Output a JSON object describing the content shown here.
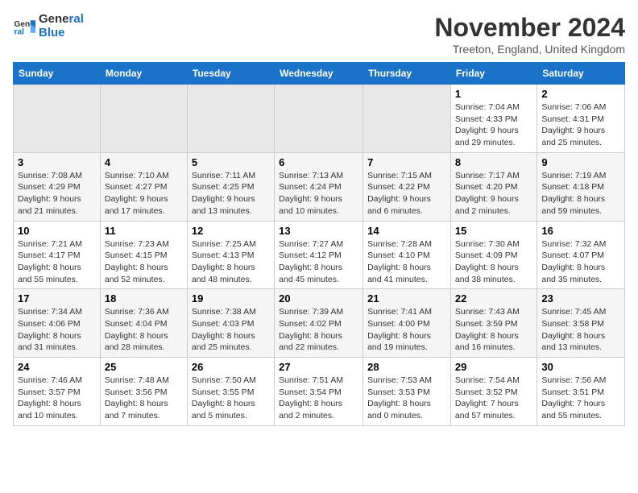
{
  "header": {
    "logo_line1": "General",
    "logo_line2": "Blue",
    "month": "November 2024",
    "location": "Treeton, England, United Kingdom"
  },
  "weekdays": [
    "Sunday",
    "Monday",
    "Tuesday",
    "Wednesday",
    "Thursday",
    "Friday",
    "Saturday"
  ],
  "weeks": [
    [
      {
        "day": "",
        "empty": true
      },
      {
        "day": "",
        "empty": true
      },
      {
        "day": "",
        "empty": true
      },
      {
        "day": "",
        "empty": true
      },
      {
        "day": "",
        "empty": true
      },
      {
        "day": "1",
        "sunrise": "Sunrise: 7:04 AM",
        "sunset": "Sunset: 4:33 PM",
        "daylight": "Daylight: 9 hours and 29 minutes."
      },
      {
        "day": "2",
        "sunrise": "Sunrise: 7:06 AM",
        "sunset": "Sunset: 4:31 PM",
        "daylight": "Daylight: 9 hours and 25 minutes."
      }
    ],
    [
      {
        "day": "3",
        "sunrise": "Sunrise: 7:08 AM",
        "sunset": "Sunset: 4:29 PM",
        "daylight": "Daylight: 9 hours and 21 minutes."
      },
      {
        "day": "4",
        "sunrise": "Sunrise: 7:10 AM",
        "sunset": "Sunset: 4:27 PM",
        "daylight": "Daylight: 9 hours and 17 minutes."
      },
      {
        "day": "5",
        "sunrise": "Sunrise: 7:11 AM",
        "sunset": "Sunset: 4:25 PM",
        "daylight": "Daylight: 9 hours and 13 minutes."
      },
      {
        "day": "6",
        "sunrise": "Sunrise: 7:13 AM",
        "sunset": "Sunset: 4:24 PM",
        "daylight": "Daylight: 9 hours and 10 minutes."
      },
      {
        "day": "7",
        "sunrise": "Sunrise: 7:15 AM",
        "sunset": "Sunset: 4:22 PM",
        "daylight": "Daylight: 9 hours and 6 minutes."
      },
      {
        "day": "8",
        "sunrise": "Sunrise: 7:17 AM",
        "sunset": "Sunset: 4:20 PM",
        "daylight": "Daylight: 9 hours and 2 minutes."
      },
      {
        "day": "9",
        "sunrise": "Sunrise: 7:19 AM",
        "sunset": "Sunset: 4:18 PM",
        "daylight": "Daylight: 8 hours and 59 minutes."
      }
    ],
    [
      {
        "day": "10",
        "sunrise": "Sunrise: 7:21 AM",
        "sunset": "Sunset: 4:17 PM",
        "daylight": "Daylight: 8 hours and 55 minutes."
      },
      {
        "day": "11",
        "sunrise": "Sunrise: 7:23 AM",
        "sunset": "Sunset: 4:15 PM",
        "daylight": "Daylight: 8 hours and 52 minutes."
      },
      {
        "day": "12",
        "sunrise": "Sunrise: 7:25 AM",
        "sunset": "Sunset: 4:13 PM",
        "daylight": "Daylight: 8 hours and 48 minutes."
      },
      {
        "day": "13",
        "sunrise": "Sunrise: 7:27 AM",
        "sunset": "Sunset: 4:12 PM",
        "daylight": "Daylight: 8 hours and 45 minutes."
      },
      {
        "day": "14",
        "sunrise": "Sunrise: 7:28 AM",
        "sunset": "Sunset: 4:10 PM",
        "daylight": "Daylight: 8 hours and 41 minutes."
      },
      {
        "day": "15",
        "sunrise": "Sunrise: 7:30 AM",
        "sunset": "Sunset: 4:09 PM",
        "daylight": "Daylight: 8 hours and 38 minutes."
      },
      {
        "day": "16",
        "sunrise": "Sunrise: 7:32 AM",
        "sunset": "Sunset: 4:07 PM",
        "daylight": "Daylight: 8 hours and 35 minutes."
      }
    ],
    [
      {
        "day": "17",
        "sunrise": "Sunrise: 7:34 AM",
        "sunset": "Sunset: 4:06 PM",
        "daylight": "Daylight: 8 hours and 31 minutes."
      },
      {
        "day": "18",
        "sunrise": "Sunrise: 7:36 AM",
        "sunset": "Sunset: 4:04 PM",
        "daylight": "Daylight: 8 hours and 28 minutes."
      },
      {
        "day": "19",
        "sunrise": "Sunrise: 7:38 AM",
        "sunset": "Sunset: 4:03 PM",
        "daylight": "Daylight: 8 hours and 25 minutes."
      },
      {
        "day": "20",
        "sunrise": "Sunrise: 7:39 AM",
        "sunset": "Sunset: 4:02 PM",
        "daylight": "Daylight: 8 hours and 22 minutes."
      },
      {
        "day": "21",
        "sunrise": "Sunrise: 7:41 AM",
        "sunset": "Sunset: 4:00 PM",
        "daylight": "Daylight: 8 hours and 19 minutes."
      },
      {
        "day": "22",
        "sunrise": "Sunrise: 7:43 AM",
        "sunset": "Sunset: 3:59 PM",
        "daylight": "Daylight: 8 hours and 16 minutes."
      },
      {
        "day": "23",
        "sunrise": "Sunrise: 7:45 AM",
        "sunset": "Sunset: 3:58 PM",
        "daylight": "Daylight: 8 hours and 13 minutes."
      }
    ],
    [
      {
        "day": "24",
        "sunrise": "Sunrise: 7:46 AM",
        "sunset": "Sunset: 3:57 PM",
        "daylight": "Daylight: 8 hours and 10 minutes."
      },
      {
        "day": "25",
        "sunrise": "Sunrise: 7:48 AM",
        "sunset": "Sunset: 3:56 PM",
        "daylight": "Daylight: 8 hours and 7 minutes."
      },
      {
        "day": "26",
        "sunrise": "Sunrise: 7:50 AM",
        "sunset": "Sunset: 3:55 PM",
        "daylight": "Daylight: 8 hours and 5 minutes."
      },
      {
        "day": "27",
        "sunrise": "Sunrise: 7:51 AM",
        "sunset": "Sunset: 3:54 PM",
        "daylight": "Daylight: 8 hours and 2 minutes."
      },
      {
        "day": "28",
        "sunrise": "Sunrise: 7:53 AM",
        "sunset": "Sunset: 3:53 PM",
        "daylight": "Daylight: 8 hours and 0 minutes."
      },
      {
        "day": "29",
        "sunrise": "Sunrise: 7:54 AM",
        "sunset": "Sunset: 3:52 PM",
        "daylight": "Daylight: 7 hours and 57 minutes."
      },
      {
        "day": "30",
        "sunrise": "Sunrise: 7:56 AM",
        "sunset": "Sunset: 3:51 PM",
        "daylight": "Daylight: 7 hours and 55 minutes."
      }
    ]
  ]
}
